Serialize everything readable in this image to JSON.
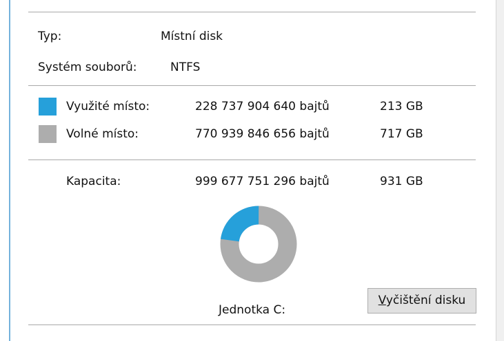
{
  "type": {
    "label": "Typ:",
    "value": "Místní disk"
  },
  "filesystem": {
    "label": "Systém souborů:",
    "value": "NTFS"
  },
  "used": {
    "label": "Využité místo:",
    "bytes": "228 737 904 640 bajtů",
    "size": "213 GB",
    "color": "#26a0da"
  },
  "free": {
    "label": "Volné místo:",
    "bytes": "770 939 846 656 bajtů",
    "size": "717 GB",
    "color": "#adadad"
  },
  "capacity": {
    "label": "Kapacita:",
    "bytes": "999 677 751 296 bajtů",
    "size": "931 GB"
  },
  "chart": {
    "used_fraction": 0.2288
  },
  "drive_label": "Jednotka C:",
  "cleanup_button": {
    "mnemonic": "V",
    "rest": "yčištění disku"
  }
}
